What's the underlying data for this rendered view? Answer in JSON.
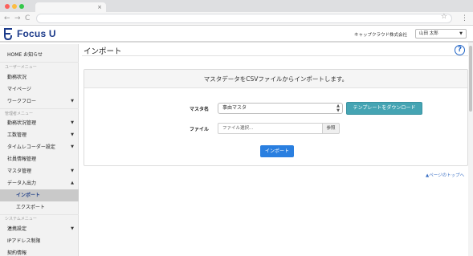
{
  "browser": {
    "tab_close": "×",
    "back": "←",
    "forward": "→",
    "reload": "C",
    "star": "☆",
    "menu": "⋮"
  },
  "header": {
    "logo_text": "Focus U",
    "company": "キャップクラウド株式会社",
    "user": "山田 太郎",
    "brand_color": "#1b3a8a"
  },
  "sidebar": {
    "home": "HOME お知らせ",
    "group_user": "ユーザーメニュー",
    "attendance": "勤務状況",
    "mypage": "マイページ",
    "workflow": "ワークフロー",
    "group_admin": "管理者メニュー",
    "attendance_mgmt": "勤務状況管理",
    "manhours": "工数管理",
    "timerecorder": "タイムレコーダー設定",
    "employees": "社員情報管理",
    "masters": "マスタ管理",
    "data_io": "データ入出力",
    "import": "インポート",
    "export": "エクスポート",
    "group_system": "システムメニュー",
    "integration": "連携設定",
    "ip_limit": "IPアドレス制限",
    "contract": "契約情報"
  },
  "main": {
    "title": "インポート",
    "help": "?",
    "panel_heading": "マスタデータをCSVファイルからインポートします。",
    "master_label": "マスタ名",
    "master_value": "事由マスタ",
    "template_button": "テンプレートをダウンロード",
    "file_label": "ファイル",
    "file_placeholder": "ファイル選択...",
    "browse_button": "参照",
    "import_button": "インポート",
    "page_top": "▲ページのトップへ",
    "accent_color": "#2a7fe0",
    "template_color": "#45a4b3"
  }
}
